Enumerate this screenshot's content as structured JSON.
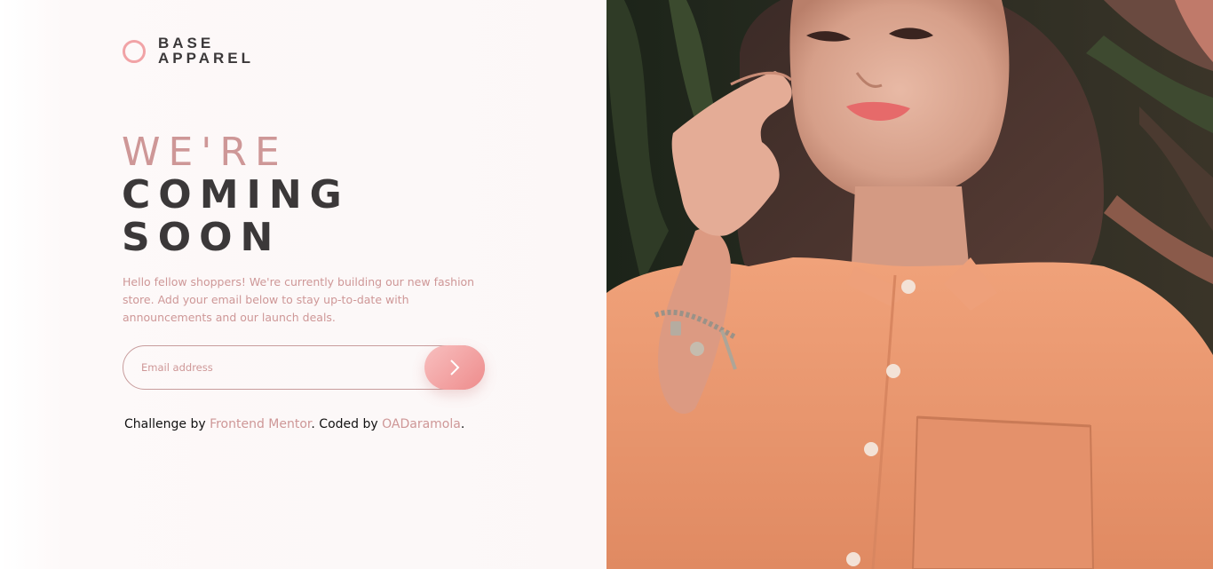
{
  "brand": {
    "line1": "BASE",
    "line2": "APPAREL"
  },
  "headline": {
    "line1": "WE'RE",
    "line2": "COMING",
    "line3": "SOON"
  },
  "intro": "Hello fellow shoppers! We're currently building our new fashion store. Add your email below to stay up-to-date with announcements and our launch deals.",
  "form": {
    "email_placeholder": "Email address",
    "submit_icon": "chevron-right-icon"
  },
  "attribution": {
    "prefix": "Challenge by",
    "link1": "Frontend Mentor",
    "middle": ". Coded by",
    "link2": "OADaramola",
    "suffix": "."
  },
  "hero": {
    "subject": "hero-photo"
  },
  "colors": {
    "accent_pink": "#ce9797",
    "dark_gray": "#3b3839",
    "gradient_start": "#f8bfbf",
    "gradient_end": "#ee8c8c",
    "logo_ring": "#f1a3a6",
    "background": "#fcf7f7"
  }
}
